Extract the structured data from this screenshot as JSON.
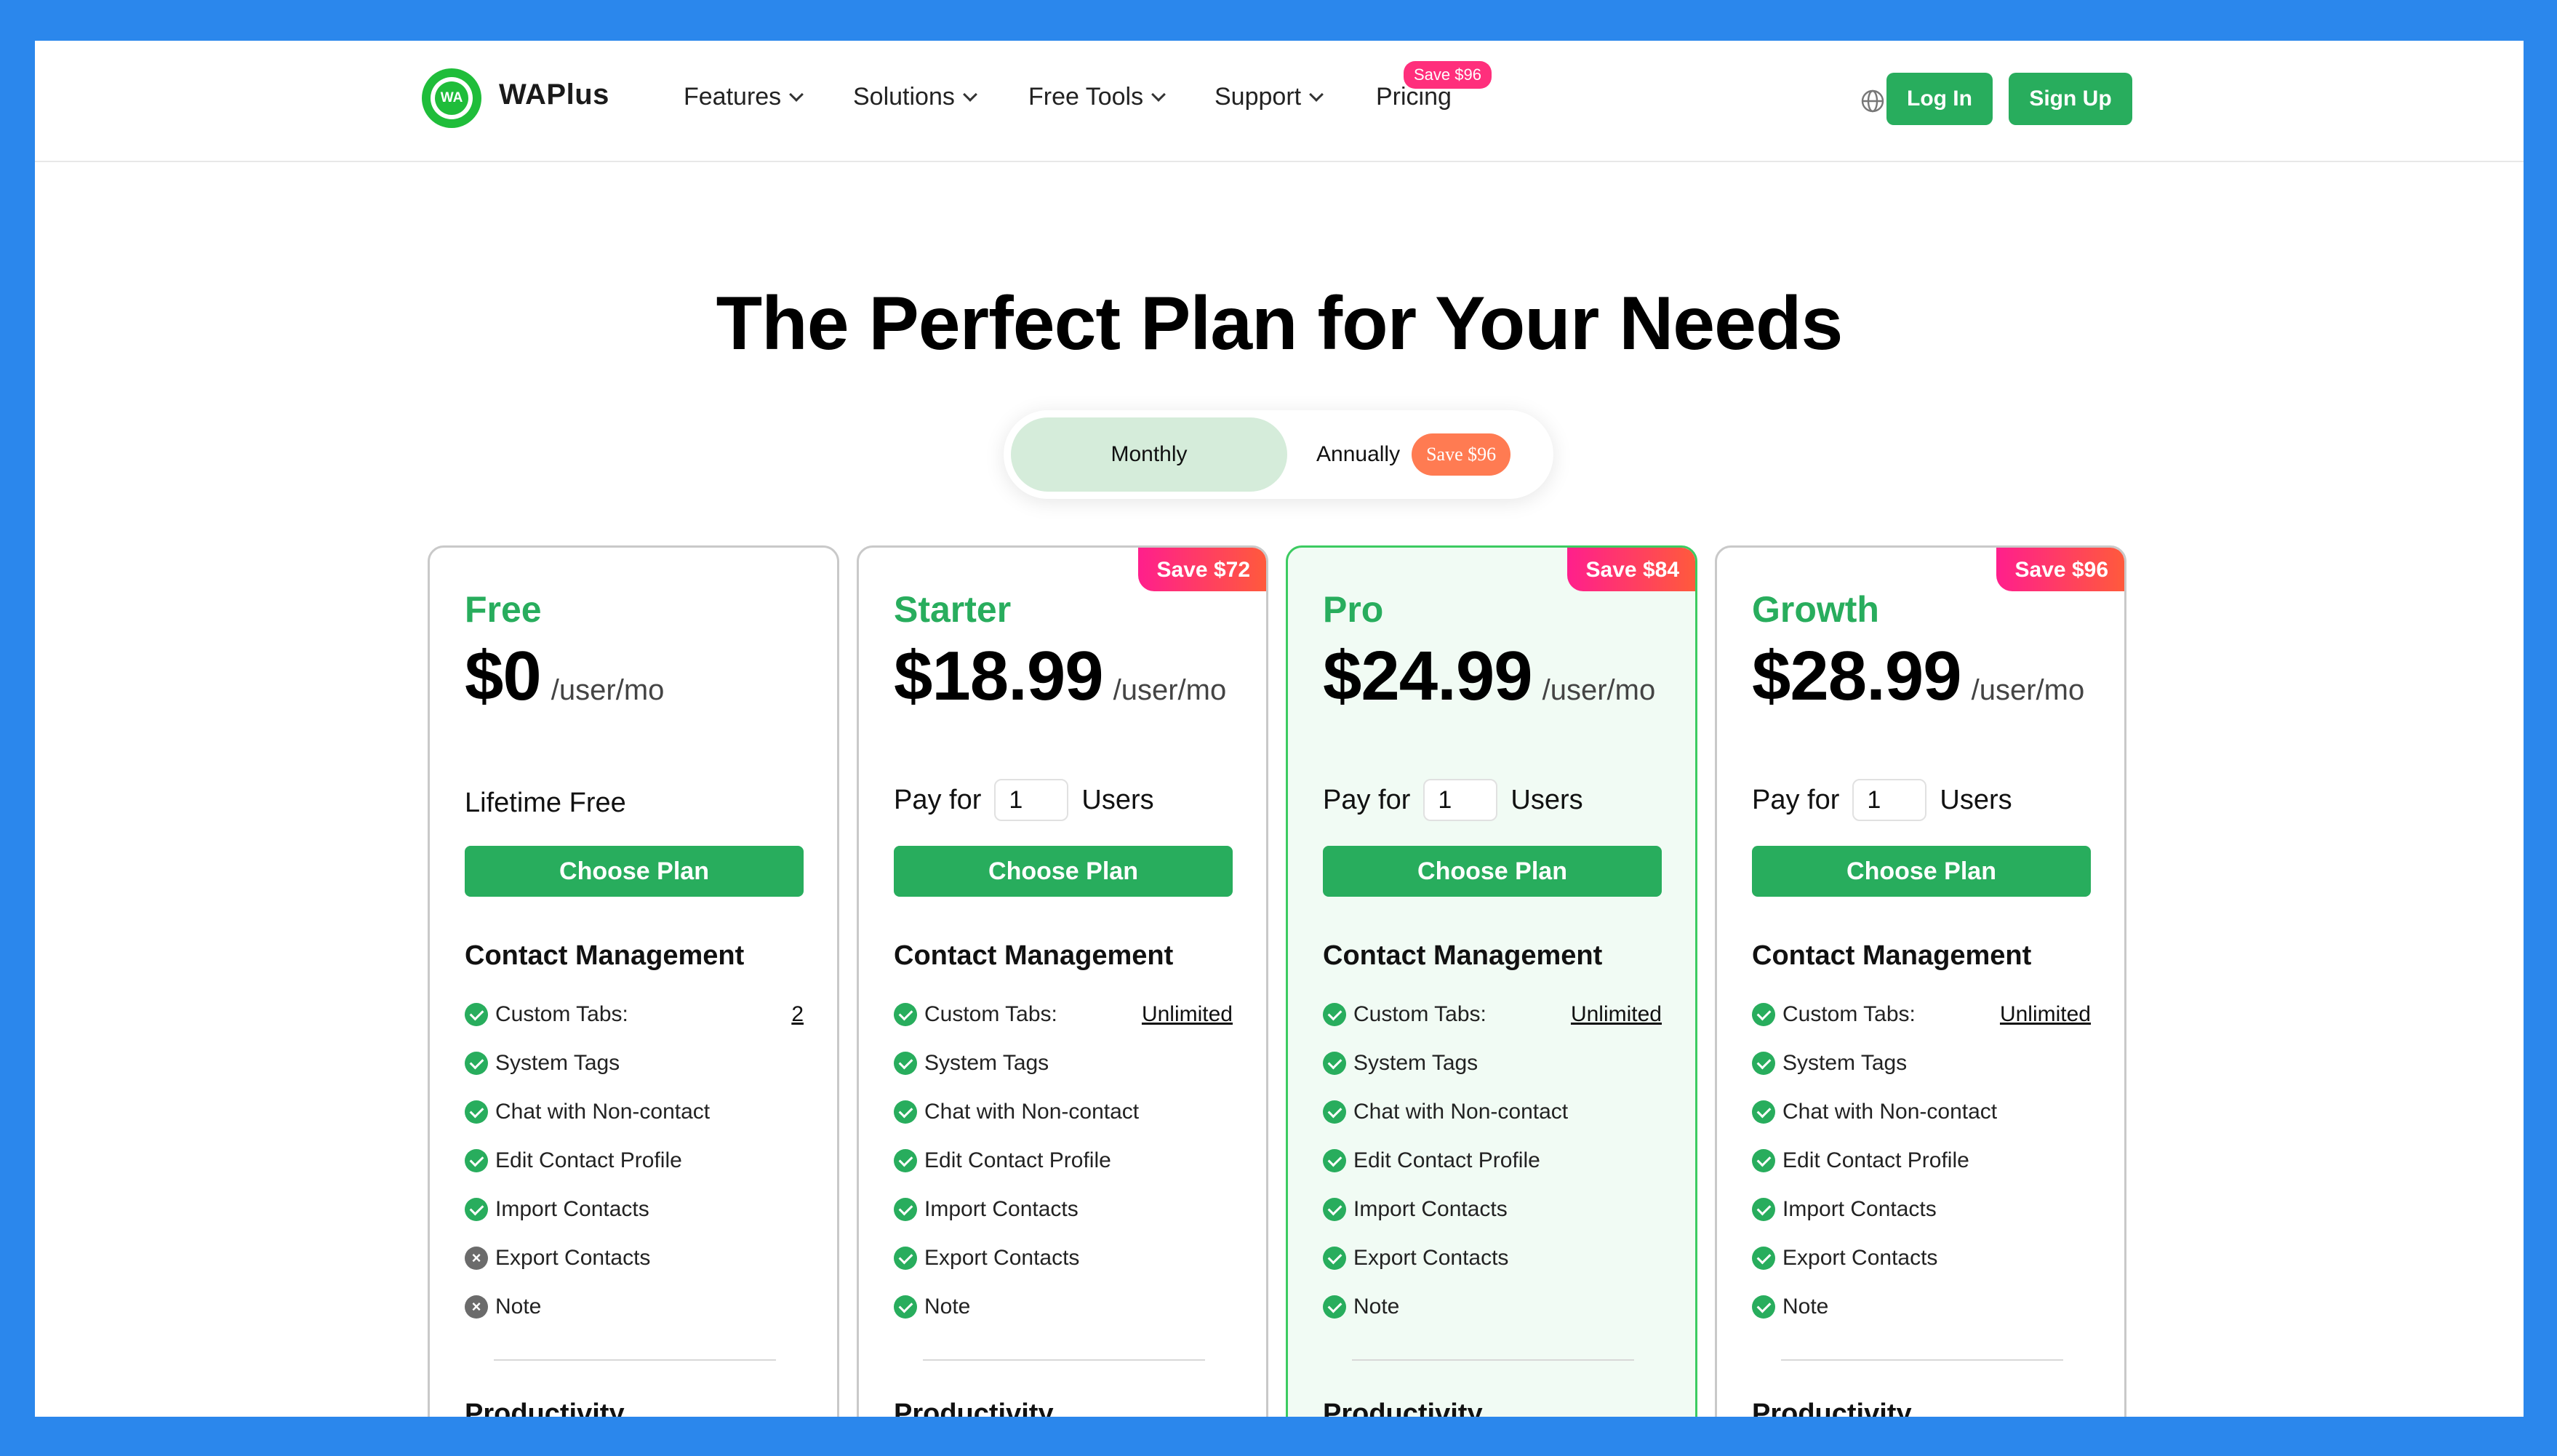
{
  "nav": {
    "brand": "WAPlus",
    "logo_text": "WA",
    "items": [
      {
        "label": "Features"
      },
      {
        "label": "Solutions"
      },
      {
        "label": "Free Tools"
      },
      {
        "label": "Support"
      },
      {
        "label": "Pricing"
      }
    ],
    "pricing_badge": "Save $96",
    "login_label": "Log In",
    "signup_label": "Sign Up",
    "icons": {
      "language": "globe-icon"
    }
  },
  "hero": {
    "title": "The Perfect Plan for Your Needs"
  },
  "billing_toggle": {
    "monthly_label": "Monthly",
    "annually_label": "Annually",
    "annually_badge": "Save $96",
    "selected": "Monthly"
  },
  "plans": [
    {
      "name": "Free",
      "price": "$0",
      "per": "/user/mo",
      "save_tag": "",
      "lifetime_text": "Lifetime Free",
      "pay_for_label": "",
      "users_label": "",
      "users_value": "",
      "button_label": "Choose Plan",
      "section_title": "Contact Management",
      "features": [
        {
          "label": "Custom Tabs:",
          "value": "2",
          "included": true
        },
        {
          "label": "System Tags",
          "value": "",
          "included": true
        },
        {
          "label": "Chat with Non-contact",
          "value": "",
          "included": true
        },
        {
          "label": "Edit Contact Profile",
          "value": "",
          "included": true
        },
        {
          "label": "Import Contacts",
          "value": "",
          "included": true
        },
        {
          "label": "Export Contacts",
          "value": "",
          "included": false
        },
        {
          "label": "Note",
          "value": "",
          "included": false
        }
      ],
      "next_section": "Productivity"
    },
    {
      "name": "Starter",
      "price": "$18.99",
      "per": "/user/mo",
      "save_tag": "Save $72",
      "lifetime_text": "",
      "pay_for_label": "Pay for",
      "users_label": "Users",
      "users_value": "1",
      "button_label": "Choose Plan",
      "section_title": "Contact Management",
      "features": [
        {
          "label": "Custom Tabs:",
          "value": "Unlimited",
          "included": true
        },
        {
          "label": "System Tags",
          "value": "",
          "included": true
        },
        {
          "label": "Chat with Non-contact",
          "value": "",
          "included": true
        },
        {
          "label": "Edit Contact Profile",
          "value": "",
          "included": true
        },
        {
          "label": "Import Contacts",
          "value": "",
          "included": true
        },
        {
          "label": "Export Contacts",
          "value": "",
          "included": true
        },
        {
          "label": "Note",
          "value": "",
          "included": true
        }
      ],
      "next_section": "Productivity"
    },
    {
      "name": "Pro",
      "price": "$24.99",
      "per": "/user/mo",
      "save_tag": "Save $84",
      "lifetime_text": "",
      "pay_for_label": "Pay for",
      "users_label": "Users",
      "users_value": "1",
      "button_label": "Choose Plan",
      "section_title": "Contact Management",
      "features": [
        {
          "label": "Custom Tabs:",
          "value": "Unlimited",
          "included": true
        },
        {
          "label": "System Tags",
          "value": "",
          "included": true
        },
        {
          "label": "Chat with Non-contact",
          "value": "",
          "included": true
        },
        {
          "label": "Edit Contact Profile",
          "value": "",
          "included": true
        },
        {
          "label": "Import Contacts",
          "value": "",
          "included": true
        },
        {
          "label": "Export Contacts",
          "value": "",
          "included": true
        },
        {
          "label": "Note",
          "value": "",
          "included": true
        }
      ],
      "next_section": "Productivity"
    },
    {
      "name": "Growth",
      "price": "$28.99",
      "per": "/user/mo",
      "save_tag": "Save $96",
      "lifetime_text": "",
      "pay_for_label": "Pay for",
      "users_label": "Users",
      "users_value": "1",
      "button_label": "Choose Plan",
      "section_title": "Contact Management",
      "features": [
        {
          "label": "Custom Tabs:",
          "value": "Unlimited",
          "included": true
        },
        {
          "label": "System Tags",
          "value": "",
          "included": true
        },
        {
          "label": "Chat with Non-contact",
          "value": "",
          "included": true
        },
        {
          "label": "Edit Contact Profile",
          "value": "",
          "included": true
        },
        {
          "label": "Import Contacts",
          "value": "",
          "included": true
        },
        {
          "label": "Export Contacts",
          "value": "",
          "included": true
        },
        {
          "label": "Note",
          "value": "",
          "included": true
        }
      ],
      "next_section": "Productivity"
    }
  ],
  "colors": {
    "background": "#2b87ec",
    "accent_green": "#28ad5d",
    "plan_name_green": "#28ad5d",
    "pro_card_bg": "#f1fbf4",
    "pro_card_border": "#3ccb61",
    "save_tag": "#ff1f8c",
    "toggle_active_bg": "#d5ecda",
    "toggle_badge": "#ff7b52"
  }
}
